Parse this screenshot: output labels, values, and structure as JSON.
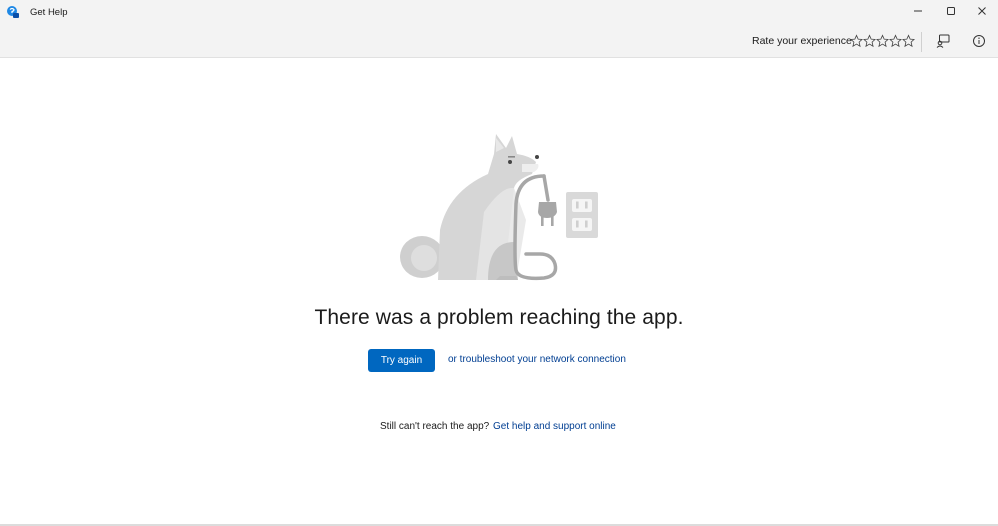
{
  "window": {
    "title": "Get Help",
    "app_icon": "get-help-icon",
    "controls": [
      "minimize-icon",
      "maximize-icon",
      "close-icon"
    ]
  },
  "toolbar": {
    "rate_label": "Rate your experience",
    "rating": {
      "stars_total": 5,
      "stars_filled": 0
    },
    "feedback_icon": "feedback-icon",
    "info_icon": "info-icon"
  },
  "error": {
    "illustration": "dog-holding-unplugged-cord",
    "headline": "There was a problem reaching the app.",
    "try_again_label": "Try again",
    "troubleshoot_link": "or troubleshoot your network connection",
    "still_text": "Still can't reach the app?",
    "support_link": "Get help and support online"
  },
  "colors": {
    "accent": "#0067c0",
    "link": "#003e92",
    "titlebar_bg": "#f3f3f3"
  }
}
